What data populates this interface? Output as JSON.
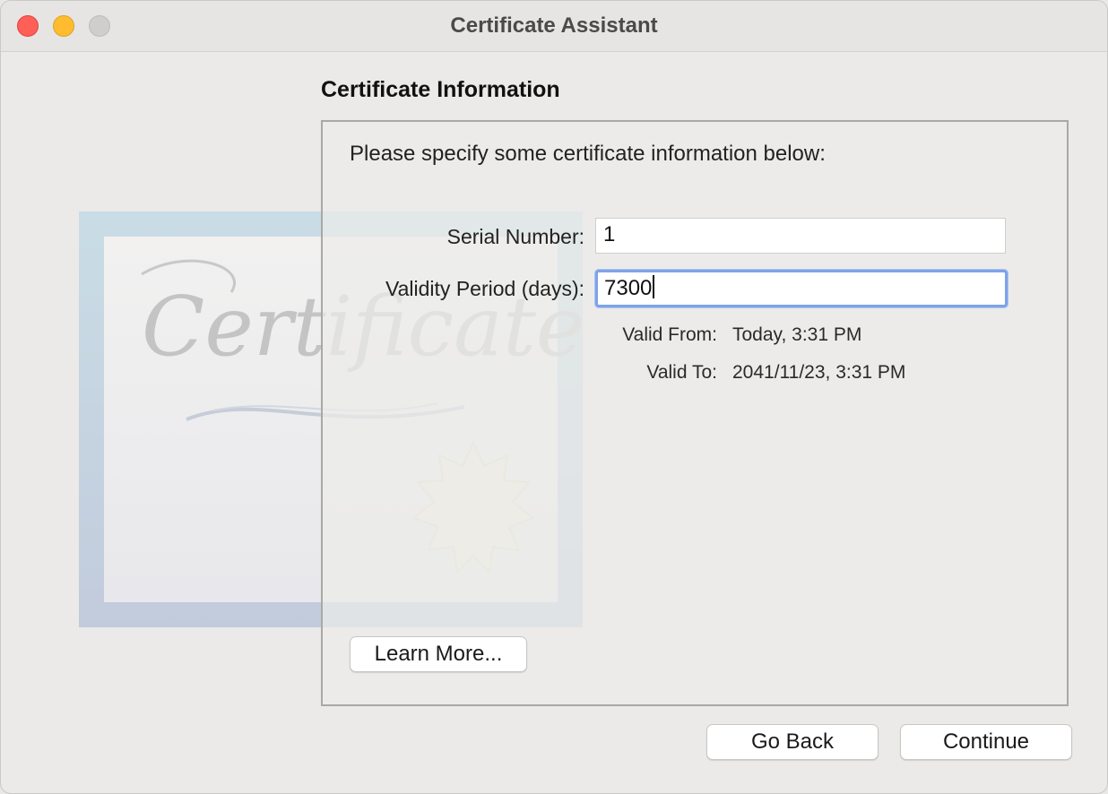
{
  "window": {
    "title": "Certificate Assistant"
  },
  "artwork": {
    "caption": "Certificate"
  },
  "section": {
    "title": "Certificate Information"
  },
  "panel": {
    "intro": "Please specify some certificate information below:",
    "serial_label": "Serial Number:",
    "serial_value": "1",
    "validity_label": "Validity Period (days):",
    "validity_value": "7300",
    "valid_from_label": "Valid From:",
    "valid_from_value": "Today, 3:31 PM",
    "valid_to_label": "Valid To:",
    "valid_to_value": "2041/11/23, 3:31 PM",
    "learn_more_label": "Learn More..."
  },
  "footer": {
    "back_label": "Go Back",
    "continue_label": "Continue"
  },
  "colors": {
    "close": "#fe5f57",
    "minimize": "#febc2e",
    "zoom": "#cfcecc",
    "focus_ring": "#7fa3e8"
  }
}
